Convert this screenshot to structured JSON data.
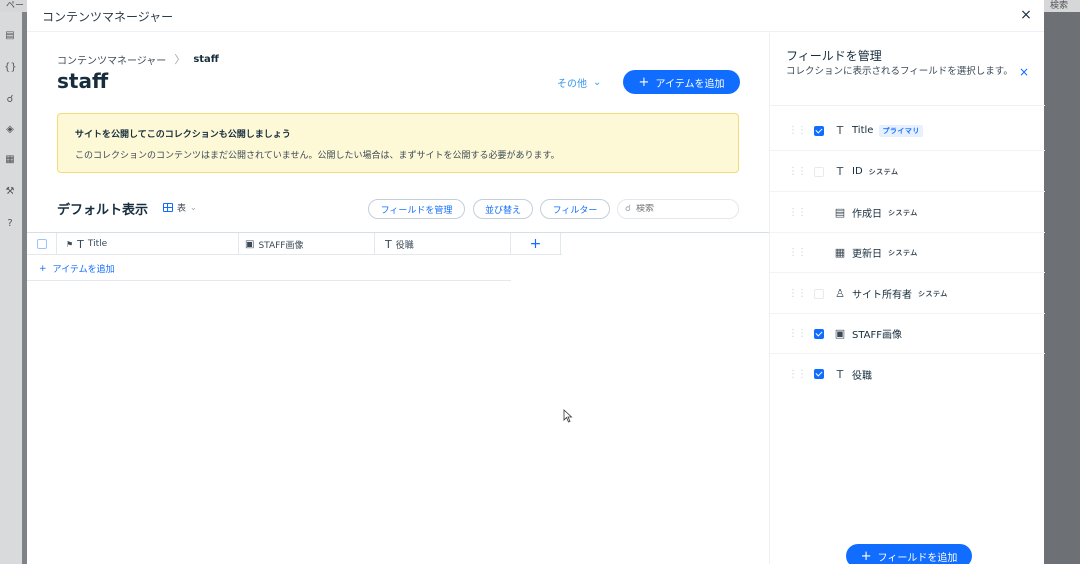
{
  "background": {
    "top_left_text": "ペー",
    "top_right_text": "検索"
  },
  "modal": {
    "title": "コンテンツマネージャー",
    "close_icon": "×"
  },
  "main": {
    "breadcrumb": {
      "root": "コンテンツマネージャー",
      "separator": "〉",
      "current": "staff"
    },
    "page_title": "staff",
    "more_label": "その他",
    "add_item_label": "アイテムを追加",
    "notice": {
      "title": "サイトを公開してこのコレクションも公開しましょう",
      "body": "このコレクションのコンテンツはまだ公開されていません。公開したい場合は、まずサイトを公開する必要があります。"
    },
    "view_title": "デフォルト表示",
    "view_type": "表",
    "manage_fields_label": "フィールドを管理",
    "sort_label": "並び替え",
    "filter_label": "フィルター",
    "search_placeholder": "検索",
    "table": {
      "columns": [
        {
          "label": "Title",
          "icon": "T"
        },
        {
          "label": "STAFF画像",
          "icon": "image"
        },
        {
          "label": "役職",
          "icon": "T"
        }
      ],
      "add_column": "+",
      "add_row_label": "アイテムを追加"
    }
  },
  "panel": {
    "title": "フィールドを管理",
    "subtitle": "コレクションに表示されるフィールドを選択します。",
    "close_icon": "×",
    "fields": [
      {
        "name": "Title",
        "tag": "プライマリ",
        "checked": true,
        "icon": "T"
      },
      {
        "name": "ID",
        "tag": "システム",
        "checked": false,
        "icon": "T"
      },
      {
        "name": "作成日",
        "tag": "システム",
        "checked": false,
        "icon": "calendar"
      },
      {
        "name": "更新日",
        "tag": "システム",
        "checked": false,
        "icon": "calendar-edit"
      },
      {
        "name": "サイト所有者",
        "tag": "システム",
        "checked": false,
        "icon": "person"
      },
      {
        "name": "STAFF画像",
        "tag": "",
        "checked": true,
        "icon": "image"
      },
      {
        "name": "役職",
        "tag": "",
        "checked": true,
        "icon": "T"
      }
    ],
    "add_field_label": "フィールドを追加"
  },
  "colors": {
    "accent": "#116dff",
    "notice_bg": "#fdf8d6",
    "notice_border": "#f0dc7a"
  }
}
